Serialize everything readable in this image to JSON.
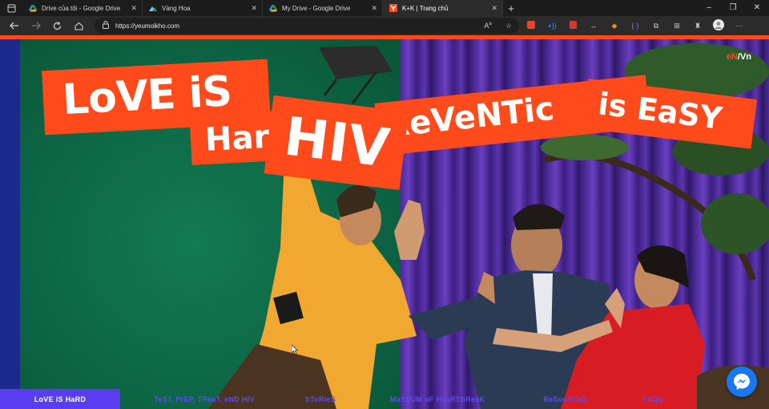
{
  "browser": {
    "tabs": [
      {
        "title": "Drive của tôi - Google Drive",
        "icon": "google-drive-icon",
        "active": false
      },
      {
        "title": "Vàng Hoa",
        "icon": "site-icon",
        "active": false
      },
      {
        "title": "My Drive - Google Drive",
        "icon": "google-drive-icon",
        "active": false
      },
      {
        "title": "K+K | Trang chủ",
        "icon": "yeumoikho-icon",
        "active": true
      }
    ],
    "new_tab": "+",
    "url": "https://yeumoikho.com",
    "window_controls": [
      "–",
      "❐",
      "✕"
    ]
  },
  "hero": {
    "lang_en": "eN",
    "lang_sep": "/",
    "lang_vn": "Vn",
    "banner_1": "LoVE iS",
    "banner_2": "Har",
    "banner_3": "ReVeNTic",
    "banner_4": "is EaSY",
    "banner_5": "HIV"
  },
  "bottom_nav": [
    {
      "label": "LoVE iS HaRD",
      "active": true
    },
    {
      "label": "TeST, PrEP, TReaT, eND HIV",
      "active": false
    },
    {
      "label": "SToRieS",
      "active": false
    },
    {
      "label": "MuSEUM oF HeaRTBReaK",
      "active": false
    },
    {
      "label": "ReSouRCeS",
      "active": false
    },
    {
      "label": "FAQs",
      "active": false
    }
  ],
  "colors": {
    "accent": "#ff4a1c",
    "nav_text": "#5d4bf0",
    "nav_active_bg": "#5a3df0",
    "messenger": "#1877f2"
  }
}
